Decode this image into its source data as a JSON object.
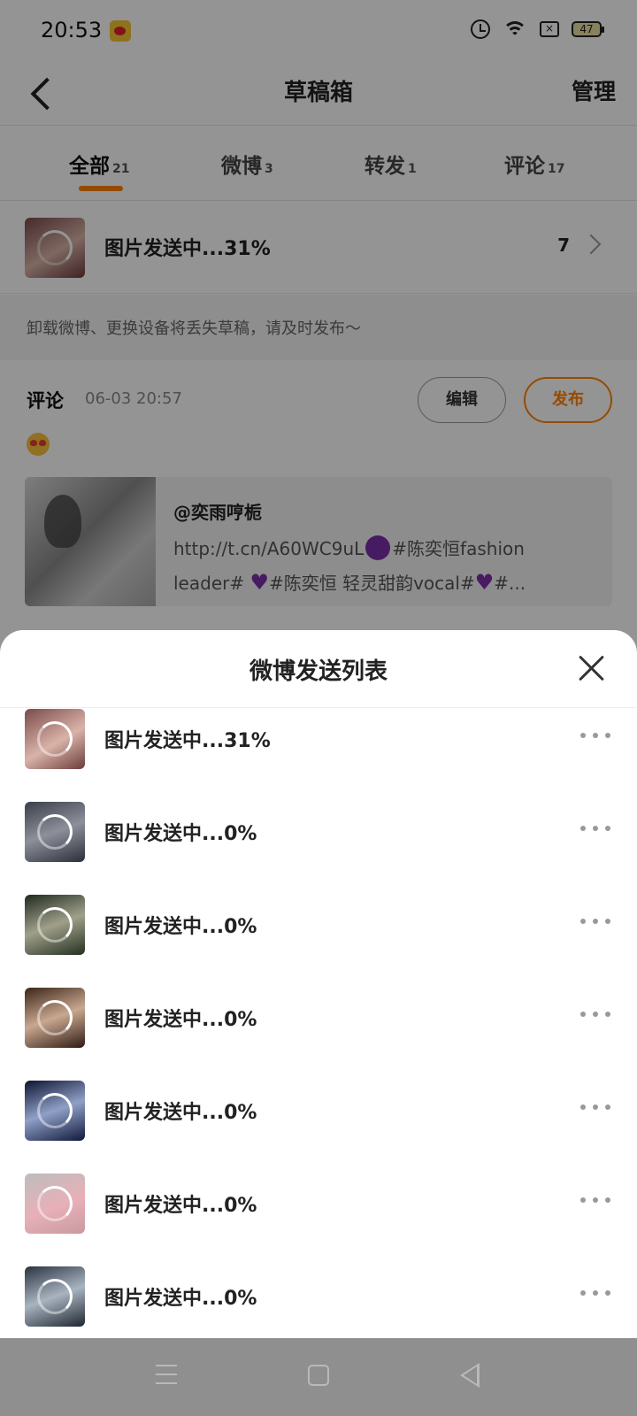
{
  "status_bar": {
    "time": "20:53",
    "battery": "47",
    "icons": [
      "weibo-notification-icon",
      "alarm-icon",
      "wifi-icon",
      "sim-icon",
      "battery-icon"
    ]
  },
  "header": {
    "title": "草稿箱",
    "manage_label": "管理",
    "back_icon": "chevron-left-icon"
  },
  "tabs": [
    {
      "label": "全部",
      "count": "21",
      "active": true
    },
    {
      "label": "微博",
      "count": "3",
      "active": false
    },
    {
      "label": "转发",
      "count": "1",
      "active": false
    },
    {
      "label": "评论",
      "count": "17",
      "active": false
    }
  ],
  "accent_color": "#ff8200",
  "sending_banner": {
    "label": "图片发送中...31%",
    "count": "7",
    "progress": 31
  },
  "warning": "卸载微博、更换设备将丢失草稿，请及时发布～",
  "draft": {
    "type": "评论",
    "date": "06-03 20:57",
    "edit_label": "编辑",
    "publish_label": "发布",
    "emoji": "heart-eyes-emoji-icon",
    "quote": {
      "author": "@奕雨哼栀",
      "line1_a": "http://t.cn/A60WC9uL",
      "line1_b": "#陈奕恒fashion",
      "line2_a": "leader# ",
      "line2_b": "#陈奕恒 轻灵甜韵vocal#",
      "line2_c": "#..."
    }
  },
  "sheet": {
    "title": "微博发送列表",
    "items": [
      {
        "label": "图片发送中...31%",
        "progress": 31
      },
      {
        "label": "图片发送中...0%",
        "progress": 0
      },
      {
        "label": "图片发送中...0%",
        "progress": 0
      },
      {
        "label": "图片发送中...0%",
        "progress": 0
      },
      {
        "label": "图片发送中...0%",
        "progress": 0
      },
      {
        "label": "图片发送中...0%",
        "progress": 0
      },
      {
        "label": "图片发送中...0%",
        "progress": 0
      }
    ]
  }
}
